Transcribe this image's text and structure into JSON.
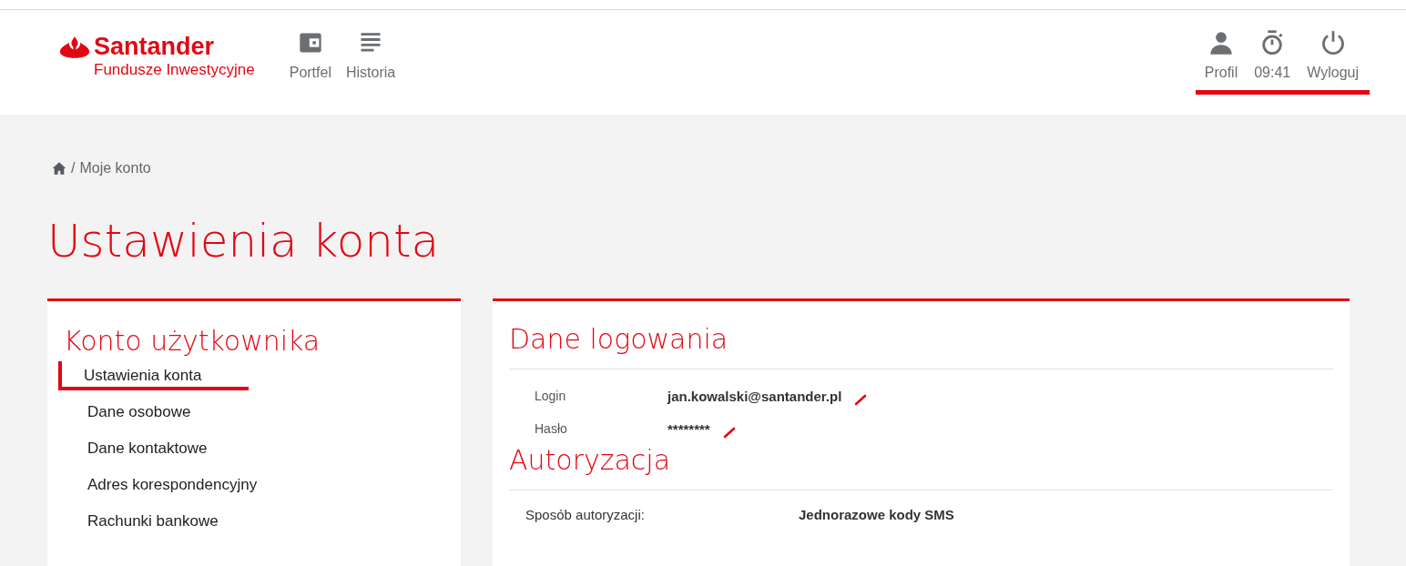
{
  "brand": {
    "name": "Santander",
    "subtitle": "Fundusze Inwestycyjne"
  },
  "nav": [
    {
      "label": "Portfel",
      "kind": "wallet"
    },
    {
      "label": "Historia",
      "kind": "list"
    }
  ],
  "user_menu": {
    "highlighted": true,
    "items": [
      {
        "label": "Profil",
        "kind": "person"
      },
      {
        "label": "09:41",
        "kind": "timer"
      },
      {
        "label": "Wyloguj",
        "kind": "power"
      }
    ]
  },
  "breadcrumb": {
    "separator": "/",
    "items": [
      "Moje konto"
    ]
  },
  "page_title": "Ustawienia konta",
  "sidebar": {
    "title": "Konto użytkownika",
    "items": [
      {
        "label": "Ustawienia konta",
        "selected": true
      },
      {
        "label": "Dane osobowe",
        "selected": false
      },
      {
        "label": "Dane kontaktowe",
        "selected": false
      },
      {
        "label": "Adres korespondencyjny",
        "selected": false
      },
      {
        "label": "Rachunki bankowe",
        "selected": false
      }
    ]
  },
  "sections": [
    {
      "title": "Dane logowania",
      "kind": "editable",
      "rows": [
        {
          "label": "Login",
          "value": "jan.kowalski@santander.pl"
        },
        {
          "label": "Hasło",
          "value": "********"
        }
      ]
    },
    {
      "title": "Autoryzacja",
      "kind": "plain",
      "rows": [
        {
          "label": "Sposób autoryzacji:",
          "value": "Jednorazowe kody SMS"
        }
      ]
    }
  ]
}
